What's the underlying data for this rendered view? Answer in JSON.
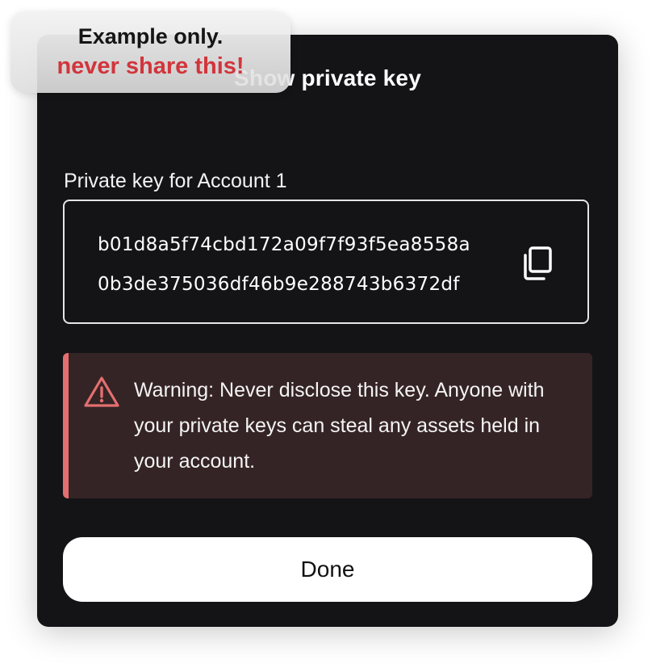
{
  "overlay": {
    "line1": "Example only.",
    "line2": "never share this!"
  },
  "modal": {
    "title": "Show private key",
    "field_label": "Private key for Account 1",
    "key_lines": [
      "b01d8a5f74cbd172a09f7f93f5ea8558a",
      "0b3de375036df46b9e288743b6372df"
    ],
    "copy_icon": "copy-icon",
    "warning_icon": "warning-triangle-icon",
    "warning_text": "Warning: Never disclose this key. Anyone with your private keys can steal any assets held in your account.",
    "done_label": "Done"
  },
  "colors": {
    "modal_background": "#141416",
    "warning_background": "#352426",
    "warning_accent": "#e36f6f",
    "overlay_text_red": "#d1353b"
  }
}
